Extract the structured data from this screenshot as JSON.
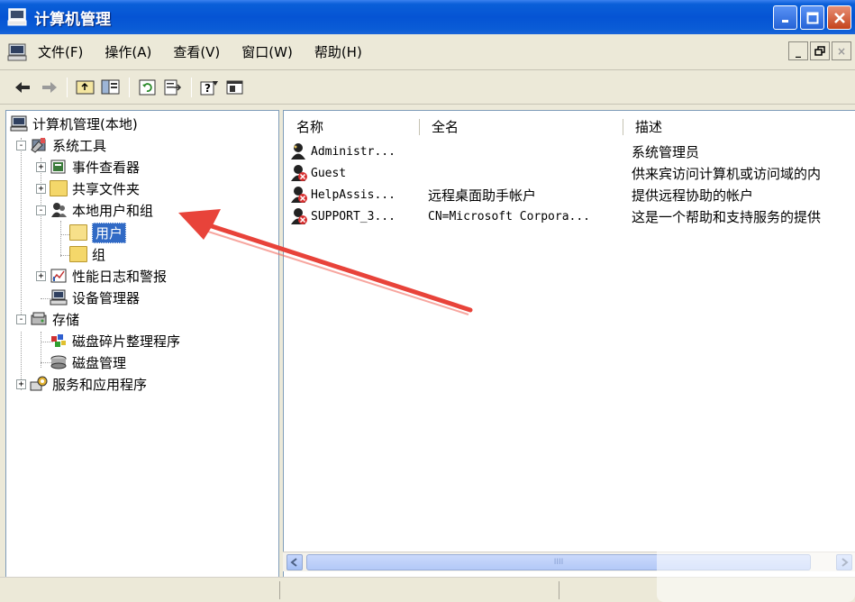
{
  "window": {
    "title": "计算机管理"
  },
  "menubar": {
    "items": [
      "文件(F)",
      "操作(A)",
      "查看(V)",
      "窗口(W)",
      "帮助(H)"
    ]
  },
  "toolbar": {
    "icons": [
      "back-arrow-icon",
      "forward-arrow-icon",
      "up-folder-icon",
      "show-hide-tree-icon",
      "refresh-icon",
      "export-list-icon",
      "help-icon",
      "console-icon"
    ]
  },
  "tree": {
    "root": "计算机管理(本地)",
    "items": [
      {
        "label": "系统工具",
        "expander": "-"
      },
      {
        "label": "事件查看器",
        "expander": "+"
      },
      {
        "label": "共享文件夹",
        "expander": "+"
      },
      {
        "label": "本地用户和组",
        "expander": "-"
      },
      {
        "label": "用户",
        "selected": true
      },
      {
        "label": "组"
      },
      {
        "label": "性能日志和警报",
        "expander": "+"
      },
      {
        "label": "设备管理器"
      },
      {
        "label": "存储",
        "expander": "-"
      },
      {
        "label": "磁盘碎片整理程序"
      },
      {
        "label": "磁盘管理"
      },
      {
        "label": "服务和应用程序",
        "expander": "+"
      }
    ]
  },
  "list": {
    "columns": [
      "名称",
      "全名",
      "描述"
    ],
    "rows": [
      {
        "name": "Administr...",
        "full_name": "",
        "description": "系统管理员",
        "disabled": false
      },
      {
        "name": "Guest",
        "full_name": "",
        "description": "供来宾访问计算机或访问域的内",
        "disabled": true
      },
      {
        "name": "HelpAssis...",
        "full_name": "远程桌面助手帐户",
        "description": "提供远程协助的帐户",
        "disabled": true
      },
      {
        "name": "SUPPORT_3...",
        "full_name": "CN=Microsoft Corpora...",
        "description": "这是一个帮助和支持服务的提供",
        "disabled": true
      }
    ]
  },
  "scrollbar": {
    "thumb_grip": "IIII"
  },
  "colors": {
    "titlebar": "#0554d4",
    "selection": "#316ac5",
    "annotation_arrow": "#e8433a"
  }
}
